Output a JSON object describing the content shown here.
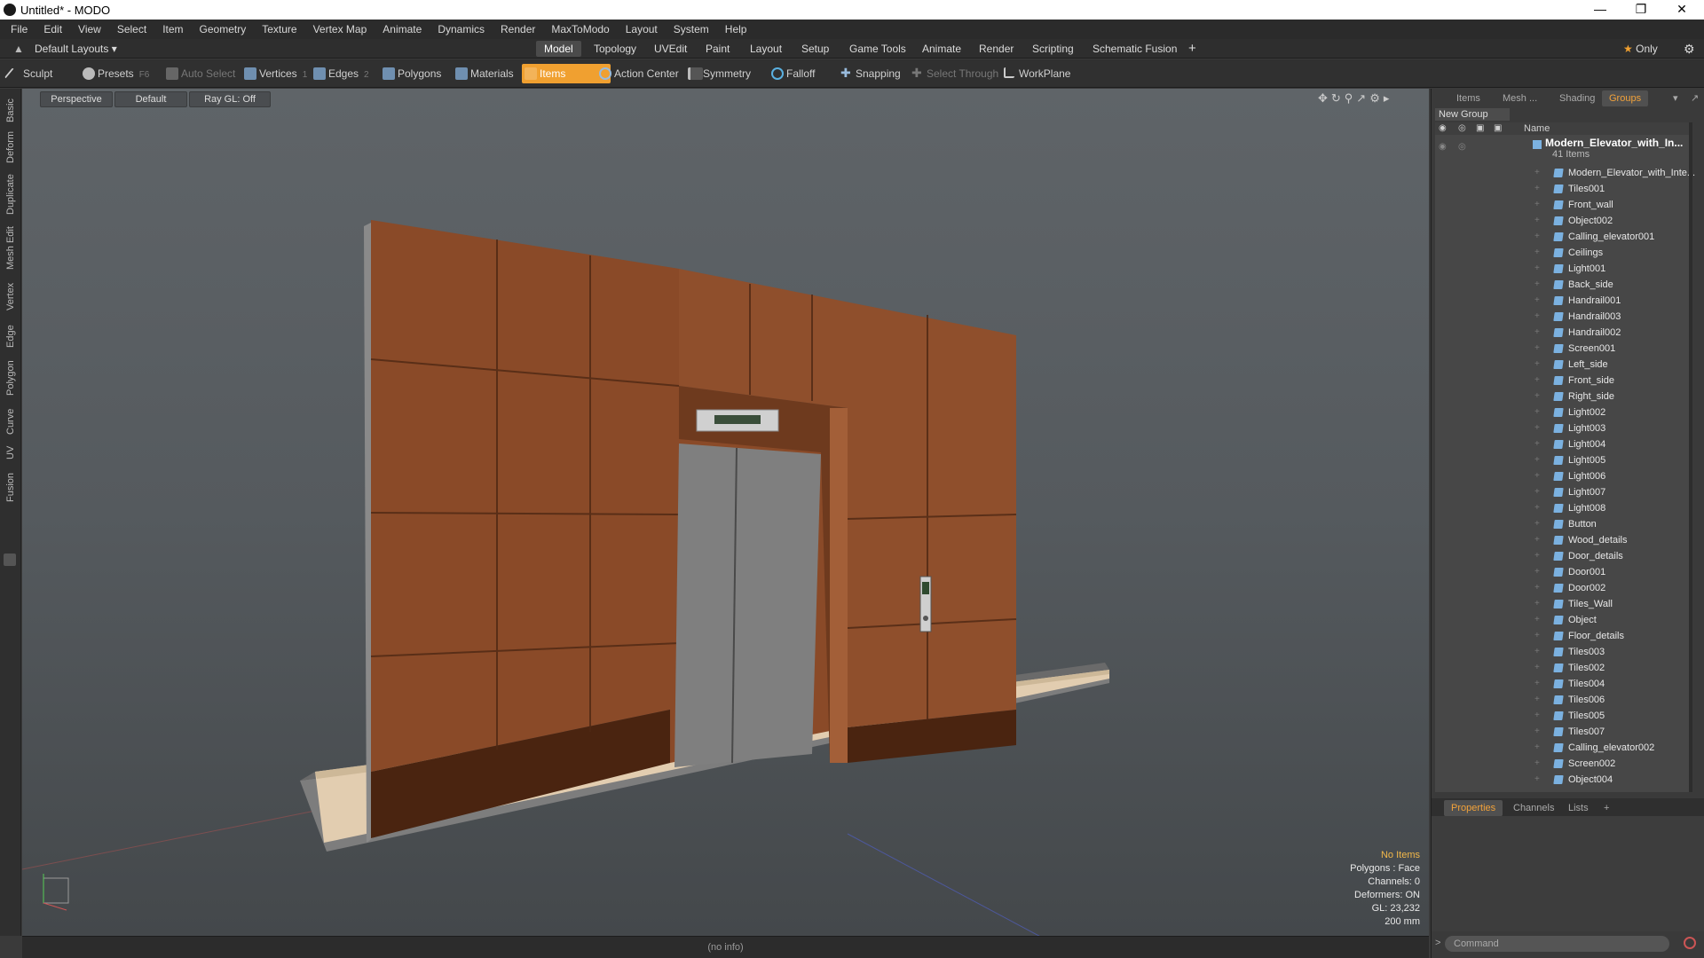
{
  "window": {
    "title": "Untitled* - MODO",
    "minimize": "—",
    "maximize": "❐",
    "close": "✕"
  },
  "menu": [
    "File",
    "Edit",
    "View",
    "Select",
    "Item",
    "Geometry",
    "Texture",
    "Vertex Map",
    "Animate",
    "Dynamics",
    "Render",
    "MaxToModo",
    "Layout",
    "System",
    "Help"
  ],
  "layout": {
    "selector": "Default Layouts",
    "tabs": [
      "Model",
      "Topology",
      "UVEdit",
      "Paint",
      "Layout",
      "Setup",
      "Game Tools",
      "Animate",
      "Render",
      "Scripting",
      "Schematic Fusion"
    ],
    "active_tab": "Model",
    "add": "+",
    "only": "Only"
  },
  "toolbar": {
    "sculpt": "Sculpt",
    "presets": "Presets",
    "presets_hotkey": "F6",
    "auto_select": "Auto Select",
    "vertices": "Vertices",
    "vertices_hotkey": "1",
    "edges": "Edges",
    "edges_hotkey": "2",
    "polygons": "Polygons",
    "materials": "Materials",
    "items": "Items",
    "action_center": "Action Center",
    "symmetry": "Symmetry",
    "falloff": "Falloff",
    "snapping": "Snapping",
    "select_through": "Select Through",
    "workplane": "WorkPlane"
  },
  "left_tabs": [
    "Basic",
    "Deform",
    "Duplicate",
    "Mesh Edit",
    "Vertex",
    "Edge",
    "Polygon",
    "Curve",
    "UV",
    "Fusion"
  ],
  "viewport": {
    "view": "Perspective",
    "shading": "Default",
    "raygl": "Ray GL: Off",
    "hud": [
      "No Items",
      "Polygons : Face",
      "Channels: 0",
      "Deformers: ON",
      "GL: 23,232",
      "200 mm"
    ],
    "status": "(no info)"
  },
  "panel": {
    "tabs": [
      "Items",
      "Mesh ...",
      "Shading",
      "Groups"
    ],
    "active_tab": "Groups",
    "new_group": "New Group",
    "name_header": "Name",
    "group_name": "Modern_Elevator_with_In...",
    "group_count": "41 Items",
    "items": [
      "Modern_Elevator_with_Inte...",
      "Tiles001",
      "Front_wall",
      "Object002",
      "Calling_elevator001",
      "Ceilings",
      "Light001",
      "Back_side",
      "Handrail001",
      "Handrail003",
      "Handrail002",
      "Screen001",
      "Left_side",
      "Front_side",
      "Right_side",
      "Light002",
      "Light003",
      "Light004",
      "Light005",
      "Light006",
      "Light007",
      "Light008",
      "Button",
      "Wood_details",
      "Door_details",
      "Door001",
      "Door002",
      "Tiles_Wall",
      "Object",
      "Floor_details",
      "Tiles003",
      "Tiles002",
      "Tiles004",
      "Tiles006",
      "Tiles005",
      "Tiles007",
      "Calling_elevator002",
      "Screen002",
      "Object004"
    ],
    "bottom_tabs": [
      "Properties",
      "Channels",
      "Lists"
    ],
    "bottom_active": "Properties",
    "command_placeholder": "Command"
  },
  "colors": {
    "accent": "#f0a030",
    "mesh_icon": "#7bb1e0",
    "wood": "#8a4a28"
  }
}
